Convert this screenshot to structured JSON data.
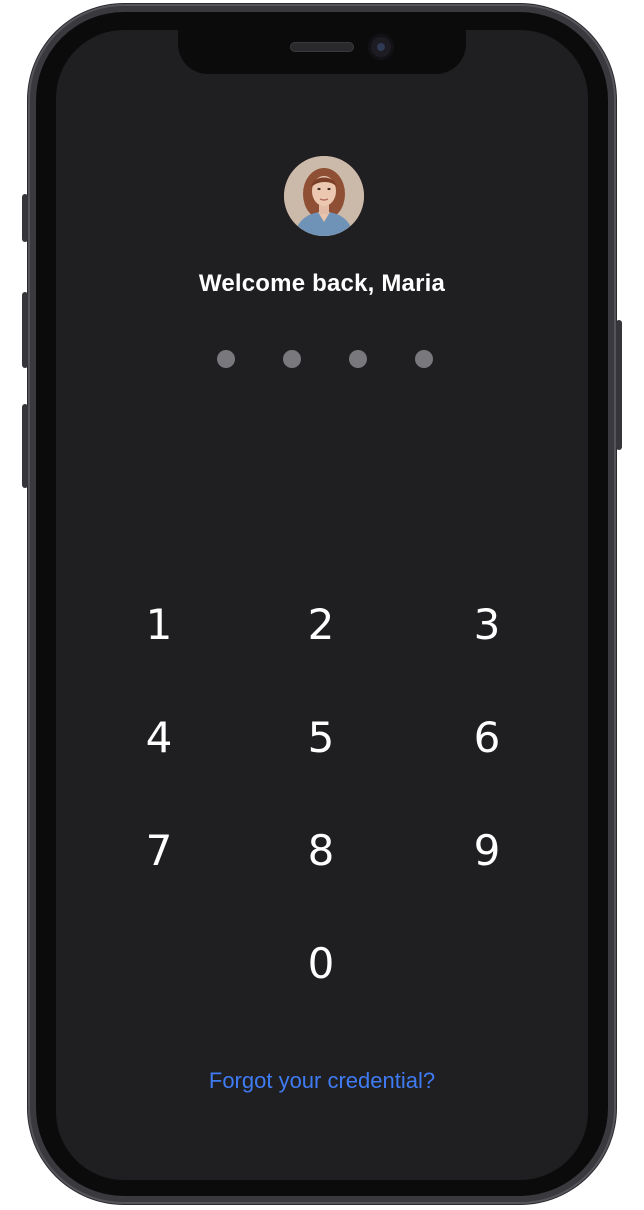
{
  "user": {
    "greeting": "Welcome back, Maria"
  },
  "pin": {
    "length": 4,
    "entered": 0
  },
  "keypad": {
    "keys": [
      "1",
      "2",
      "3",
      "4",
      "5",
      "6",
      "7",
      "8",
      "9",
      "0"
    ]
  },
  "links": {
    "forgot": "Forgot your credential?"
  },
  "colors": {
    "background": "#1f1e21",
    "pin_dot": "#79787d",
    "link": "#3f7bf2",
    "text": "#ffffff"
  }
}
